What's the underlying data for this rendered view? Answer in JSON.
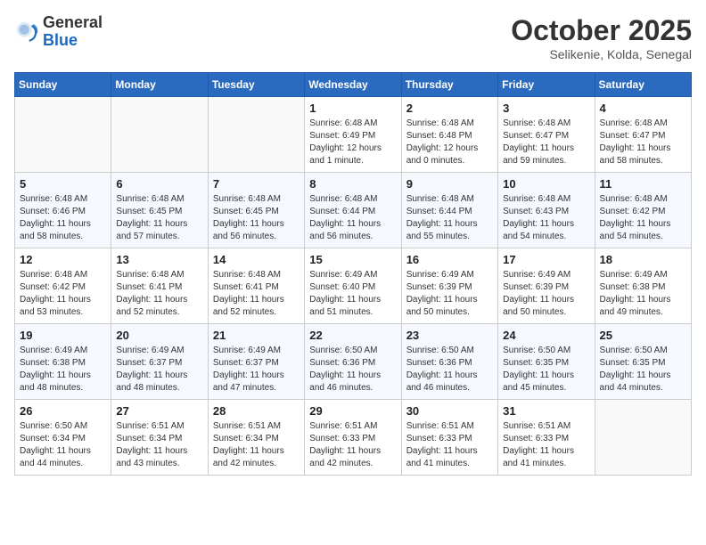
{
  "header": {
    "logo_general": "General",
    "logo_blue": "Blue",
    "month": "October 2025",
    "location": "Selikenie, Kolda, Senegal"
  },
  "days_of_week": [
    "Sunday",
    "Monday",
    "Tuesday",
    "Wednesday",
    "Thursday",
    "Friday",
    "Saturday"
  ],
  "weeks": [
    [
      {
        "num": "",
        "sunrise": "",
        "sunset": "",
        "daylight": ""
      },
      {
        "num": "",
        "sunrise": "",
        "sunset": "",
        "daylight": ""
      },
      {
        "num": "",
        "sunrise": "",
        "sunset": "",
        "daylight": ""
      },
      {
        "num": "1",
        "sunrise": "6:48 AM",
        "sunset": "6:49 PM",
        "daylight": "12 hours and 1 minute."
      },
      {
        "num": "2",
        "sunrise": "6:48 AM",
        "sunset": "6:48 PM",
        "daylight": "12 hours and 0 minutes."
      },
      {
        "num": "3",
        "sunrise": "6:48 AM",
        "sunset": "6:47 PM",
        "daylight": "11 hours and 59 minutes."
      },
      {
        "num": "4",
        "sunrise": "6:48 AM",
        "sunset": "6:47 PM",
        "daylight": "11 hours and 58 minutes."
      }
    ],
    [
      {
        "num": "5",
        "sunrise": "6:48 AM",
        "sunset": "6:46 PM",
        "daylight": "11 hours and 58 minutes."
      },
      {
        "num": "6",
        "sunrise": "6:48 AM",
        "sunset": "6:45 PM",
        "daylight": "11 hours and 57 minutes."
      },
      {
        "num": "7",
        "sunrise": "6:48 AM",
        "sunset": "6:45 PM",
        "daylight": "11 hours and 56 minutes."
      },
      {
        "num": "8",
        "sunrise": "6:48 AM",
        "sunset": "6:44 PM",
        "daylight": "11 hours and 56 minutes."
      },
      {
        "num": "9",
        "sunrise": "6:48 AM",
        "sunset": "6:44 PM",
        "daylight": "11 hours and 55 minutes."
      },
      {
        "num": "10",
        "sunrise": "6:48 AM",
        "sunset": "6:43 PM",
        "daylight": "11 hours and 54 minutes."
      },
      {
        "num": "11",
        "sunrise": "6:48 AM",
        "sunset": "6:42 PM",
        "daylight": "11 hours and 54 minutes."
      }
    ],
    [
      {
        "num": "12",
        "sunrise": "6:48 AM",
        "sunset": "6:42 PM",
        "daylight": "11 hours and 53 minutes."
      },
      {
        "num": "13",
        "sunrise": "6:48 AM",
        "sunset": "6:41 PM",
        "daylight": "11 hours and 52 minutes."
      },
      {
        "num": "14",
        "sunrise": "6:48 AM",
        "sunset": "6:41 PM",
        "daylight": "11 hours and 52 minutes."
      },
      {
        "num": "15",
        "sunrise": "6:49 AM",
        "sunset": "6:40 PM",
        "daylight": "11 hours and 51 minutes."
      },
      {
        "num": "16",
        "sunrise": "6:49 AM",
        "sunset": "6:39 PM",
        "daylight": "11 hours and 50 minutes."
      },
      {
        "num": "17",
        "sunrise": "6:49 AM",
        "sunset": "6:39 PM",
        "daylight": "11 hours and 50 minutes."
      },
      {
        "num": "18",
        "sunrise": "6:49 AM",
        "sunset": "6:38 PM",
        "daylight": "11 hours and 49 minutes."
      }
    ],
    [
      {
        "num": "19",
        "sunrise": "6:49 AM",
        "sunset": "6:38 PM",
        "daylight": "11 hours and 48 minutes."
      },
      {
        "num": "20",
        "sunrise": "6:49 AM",
        "sunset": "6:37 PM",
        "daylight": "11 hours and 48 minutes."
      },
      {
        "num": "21",
        "sunrise": "6:49 AM",
        "sunset": "6:37 PM",
        "daylight": "11 hours and 47 minutes."
      },
      {
        "num": "22",
        "sunrise": "6:50 AM",
        "sunset": "6:36 PM",
        "daylight": "11 hours and 46 minutes."
      },
      {
        "num": "23",
        "sunrise": "6:50 AM",
        "sunset": "6:36 PM",
        "daylight": "11 hours and 46 minutes."
      },
      {
        "num": "24",
        "sunrise": "6:50 AM",
        "sunset": "6:35 PM",
        "daylight": "11 hours and 45 minutes."
      },
      {
        "num": "25",
        "sunrise": "6:50 AM",
        "sunset": "6:35 PM",
        "daylight": "11 hours and 44 minutes."
      }
    ],
    [
      {
        "num": "26",
        "sunrise": "6:50 AM",
        "sunset": "6:34 PM",
        "daylight": "11 hours and 44 minutes."
      },
      {
        "num": "27",
        "sunrise": "6:51 AM",
        "sunset": "6:34 PM",
        "daylight": "11 hours and 43 minutes."
      },
      {
        "num": "28",
        "sunrise": "6:51 AM",
        "sunset": "6:34 PM",
        "daylight": "11 hours and 42 minutes."
      },
      {
        "num": "29",
        "sunrise": "6:51 AM",
        "sunset": "6:33 PM",
        "daylight": "11 hours and 42 minutes."
      },
      {
        "num": "30",
        "sunrise": "6:51 AM",
        "sunset": "6:33 PM",
        "daylight": "11 hours and 41 minutes."
      },
      {
        "num": "31",
        "sunrise": "6:51 AM",
        "sunset": "6:33 PM",
        "daylight": "11 hours and 41 minutes."
      },
      {
        "num": "",
        "sunrise": "",
        "sunset": "",
        "daylight": ""
      }
    ]
  ],
  "labels": {
    "sunrise": "Sunrise:",
    "sunset": "Sunset:",
    "daylight": "Daylight:"
  }
}
